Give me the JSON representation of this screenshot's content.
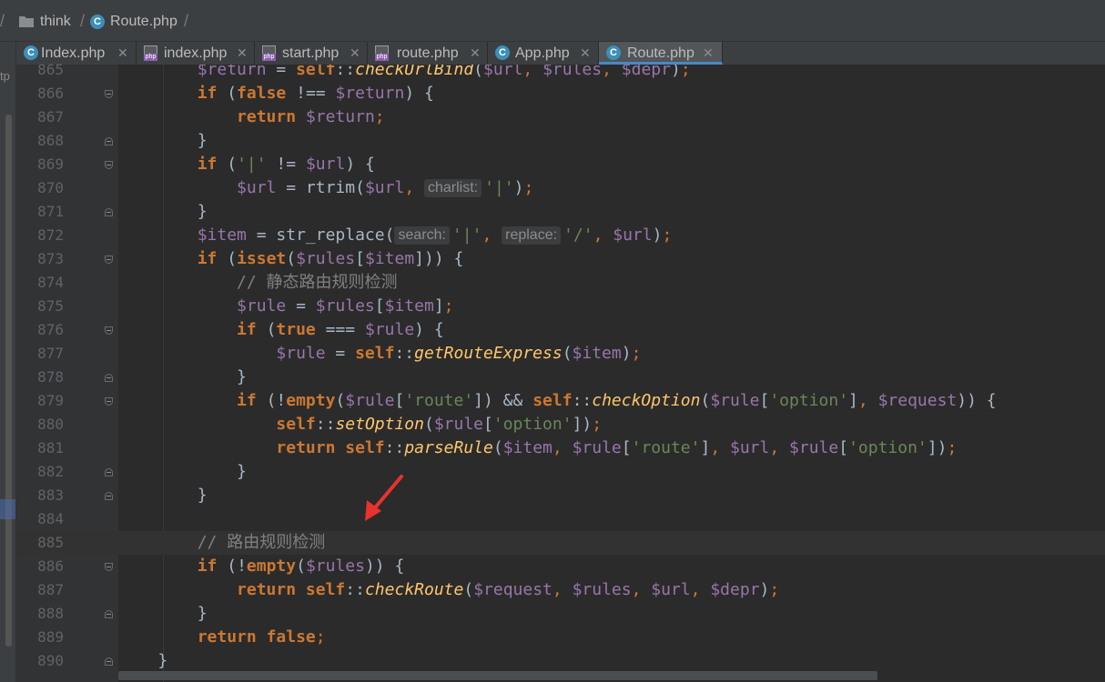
{
  "breadcrumb": {
    "items": [
      {
        "label": "think",
        "icon": "folder-icon"
      },
      {
        "label": "Route.php",
        "icon": "php-class-icon"
      }
    ]
  },
  "tabs": [
    {
      "label": "Index.php",
      "icon": "php-class-icon",
      "active": false
    },
    {
      "label": "index.php",
      "icon": "php-file-icon",
      "active": false
    },
    {
      "label": "start.php",
      "icon": "php-file-icon",
      "active": false
    },
    {
      "label": "route.php",
      "icon": "php-file-icon",
      "active": false
    },
    {
      "label": "App.php",
      "icon": "php-class-icon",
      "active": false
    },
    {
      "label": "Route.php",
      "icon": "php-class-icon",
      "active": true
    }
  ],
  "left_strip_text": "tp",
  "colors": {
    "keyword": "#cc7832",
    "variable": "#9876aa",
    "string": "#6a8759",
    "static_method": "#ffc66d",
    "comment": "#808080",
    "text": "#a9b7c6",
    "background": "#2b2b2b",
    "gutter": "#313335",
    "annotation_arrow": "#e8322e"
  },
  "editor": {
    "caret_line": "885",
    "lines": [
      {
        "num": "865",
        "code": "        $return = self::checkUrlBind($url, $rules, $depr);"
      },
      {
        "num": "866",
        "code": "        if (false !== $return) {"
      },
      {
        "num": "867",
        "code": "            return $return;"
      },
      {
        "num": "868",
        "code": "        }"
      },
      {
        "num": "869",
        "code": "        if ('|' != $url) {"
      },
      {
        "num": "870",
        "code": "            $url = rtrim($url, charlist: '|');"
      },
      {
        "num": "871",
        "code": "        }"
      },
      {
        "num": "872",
        "code": "        $item = str_replace(search: '|', replace: '/', $url);"
      },
      {
        "num": "873",
        "code": "        if (isset($rules[$item])) {"
      },
      {
        "num": "874",
        "code": "            // 静态路由规则检测"
      },
      {
        "num": "875",
        "code": "            $rule = $rules[$item];"
      },
      {
        "num": "876",
        "code": "            if (true === $rule) {"
      },
      {
        "num": "877",
        "code": "                $rule = self::getRouteExpress($item);"
      },
      {
        "num": "878",
        "code": "            }"
      },
      {
        "num": "879",
        "code": "            if (!empty($rule['route']) && self::checkOption($rule['option'], $request)) {"
      },
      {
        "num": "880",
        "code": "                self::setOption($rule['option']);"
      },
      {
        "num": "881",
        "code": "                return self::parseRule($item, $rule['route'], $url, $rule['option']);"
      },
      {
        "num": "882",
        "code": "            }"
      },
      {
        "num": "883",
        "code": "        }"
      },
      {
        "num": "884",
        "code": ""
      },
      {
        "num": "885",
        "code": "        // 路由规则检测"
      },
      {
        "num": "886",
        "code": "        if (!empty($rules)) {"
      },
      {
        "num": "887",
        "code": "            return self::checkRoute($request, $rules, $url, $depr);"
      },
      {
        "num": "888",
        "code": "        }"
      },
      {
        "num": "889",
        "code": "        return false;"
      },
      {
        "num": "890",
        "code": "    }"
      }
    ]
  }
}
